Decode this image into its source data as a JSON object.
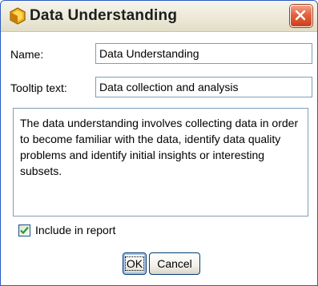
{
  "window": {
    "title": "Data Understanding",
    "icon": "gold-hexagon-icon"
  },
  "form": {
    "name_label": "Name:",
    "name_value": "Data Understanding",
    "tooltip_label": "Tooltip text:",
    "tooltip_value": "Data collection and analysis",
    "description": "The data understanding involves collecting data in order to become familiar with the data, identify data quality problems and identify initial insights or interesting subsets.",
    "include_label": "Include in report",
    "include_checked": true
  },
  "buttons": {
    "ok_label": "OK",
    "cancel_label": "Cancel"
  },
  "colors": {
    "title_bar": "#ece9d8",
    "close_button": "#e4613d",
    "field_border": "#7f9db9",
    "icon_gold": "#f2b216"
  }
}
